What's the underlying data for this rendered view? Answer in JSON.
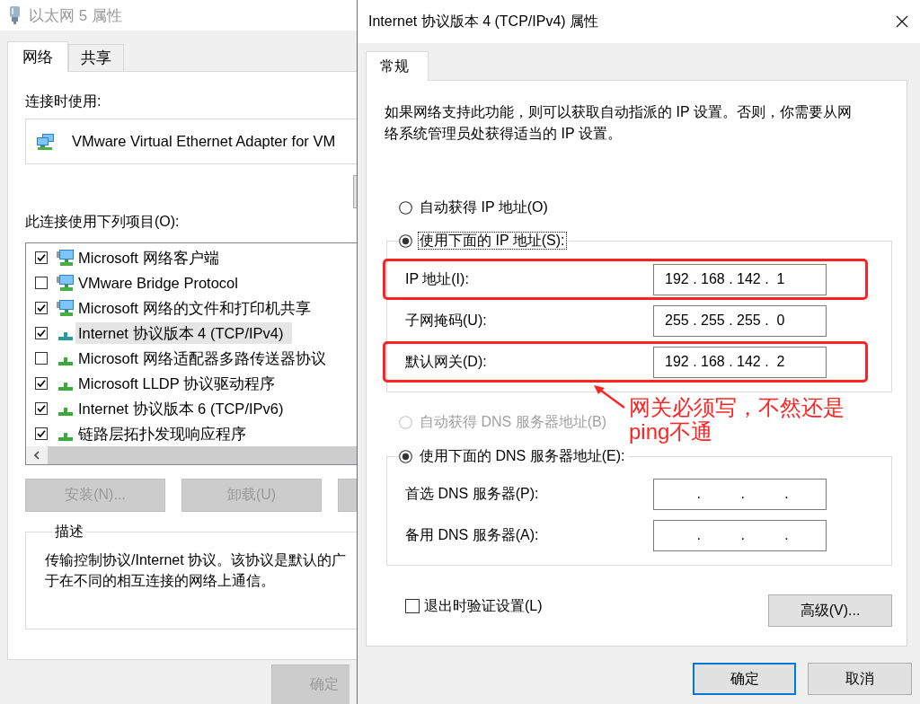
{
  "left_window": {
    "title": "以太网 5 属性",
    "active": false,
    "tabs": [
      {
        "label": "网络",
        "selected": true
      },
      {
        "label": "共享",
        "selected": false
      }
    ],
    "connect_using_label": "连接时使用:",
    "adapter": "VMware Virtual Ethernet Adapter for VM",
    "items_label": "此连接使用下列项目(O):",
    "items": [
      {
        "kind": "service",
        "label": "Microsoft 网络客户端",
        "checked": true,
        "selected": false
      },
      {
        "kind": "service",
        "label": "VMware Bridge Protocol",
        "checked": false,
        "selected": false
      },
      {
        "kind": "service",
        "label": "Microsoft 网络的文件和打印机共享",
        "checked": true,
        "selected": false
      },
      {
        "kind": "protocol",
        "label": "Internet 协议版本 4 (TCP/IPv4)",
        "checked": true,
        "selected": true
      },
      {
        "kind": "protocol",
        "label": "Microsoft 网络适配器多路传送器协议",
        "checked": false,
        "selected": false
      },
      {
        "kind": "protocol",
        "label": "Microsoft LLDP 协议驱动程序",
        "checked": true,
        "selected": false
      },
      {
        "kind": "protocol",
        "label": "Internet 协议版本 6 (TCP/IPv6)",
        "checked": true,
        "selected": false
      },
      {
        "kind": "protocol",
        "label": "链路层拓扑发现响应程序",
        "checked": true,
        "selected": false
      }
    ],
    "buttons": [
      {
        "label": "安装(N)...",
        "disabled": true
      },
      {
        "label": "卸载(U)",
        "disabled": true
      }
    ],
    "description": {
      "title": "描述",
      "lines": [
        "传输控制协议/Internet 协议。该协议是默认的广",
        "于在不同的相互连接的网络上通信。"
      ]
    },
    "ok_button": {
      "label": "确定",
      "disabled": true
    }
  },
  "ipv4_dialog": {
    "title": "Internet 协议版本 4 (TCP/IPv4) 属性",
    "active": true,
    "tabs": [
      {
        "label": "常规",
        "selected": true
      }
    ],
    "intro": "如果网络支持此功能，则可以获取自动指派的 IP 设置。否则，你需要从网络系统管理员处获得适当的 IP 设置。",
    "ip_options": [
      {
        "label": "自动获得 IP 地址(O)",
        "selected": false,
        "focused": false
      },
      {
        "label": "使用下面的 IP 地址(S):",
        "selected": true,
        "focused": true
      }
    ],
    "ip_fields": [
      {
        "label": "IP 地址(I):",
        "value": "192 . 168 . 142 .  1",
        "highlighted": true
      },
      {
        "label": "子网掩码(U):",
        "value": "255 . 255 . 255 .  0",
        "highlighted": false
      },
      {
        "label": "默认网关(D):",
        "value": "192 . 168 . 142 .  2",
        "highlighted": true
      }
    ],
    "dns_options": [
      {
        "label": "自动获得 DNS 服务器地址(B)",
        "selected": false,
        "disabled": true
      },
      {
        "label": "使用下面的 DNS 服务器地址(E):",
        "selected": true,
        "disabled": false
      }
    ],
    "dns_fields": [
      {
        "label": "首选 DNS 服务器(P):",
        "value": "        .          .          ."
      },
      {
        "label": "备用 DNS 服务器(A):",
        "value": "        .          .          ."
      }
    ],
    "validate_checkbox": {
      "label": "退出时验证设置(L)",
      "checked": false
    },
    "advanced_button": "高级(V)...",
    "buttons": [
      {
        "label": "确定",
        "default": true
      },
      {
        "label": "取消",
        "default": false
      }
    ]
  },
  "annotation": {
    "text": "网关必须写，不然还是ping不通"
  }
}
